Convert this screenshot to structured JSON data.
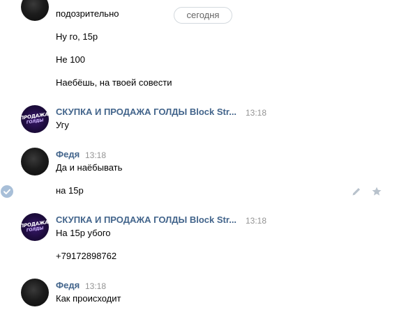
{
  "date_separator": "сегодня",
  "messages": [
    {
      "text": "подозрительно"
    },
    {
      "text": "Ну го, 15р"
    },
    {
      "text": "Не 100"
    },
    {
      "text": "Наебёшь, на твоей совести"
    },
    {
      "author": "СКУПКА И ПРОДАЖА ГОЛДЫ Block Str...",
      "time": "13:18",
      "text": "Угу",
      "avatar": "brand-logo"
    },
    {
      "author": "Федя",
      "time": "13:18",
      "text": "Да и наёбывать",
      "avatar": "photo"
    },
    {
      "text": "на 15р"
    },
    {
      "author": "СКУПКА И ПРОДАЖА ГОЛДЫ Block Str...",
      "time": "13:18",
      "text": "На 15р убого",
      "avatar": "brand-logo"
    },
    {
      "text": "+79172898762"
    },
    {
      "author": "Федя",
      "time": "13:18",
      "text": "Как происходит",
      "avatar": "photo"
    }
  ],
  "brand_logo_text": [
    "ПРОДАЖА",
    "ГОЛДЫ"
  ],
  "icons": {
    "selected": "check-circle-icon",
    "edit": "pencil-icon",
    "favorite": "star-icon"
  },
  "colors": {
    "author": "#42648b",
    "time": "#939393",
    "icon": "#a8bfd8",
    "action_icon": "#b8c2cc",
    "pill_border": "#d3d9de"
  }
}
